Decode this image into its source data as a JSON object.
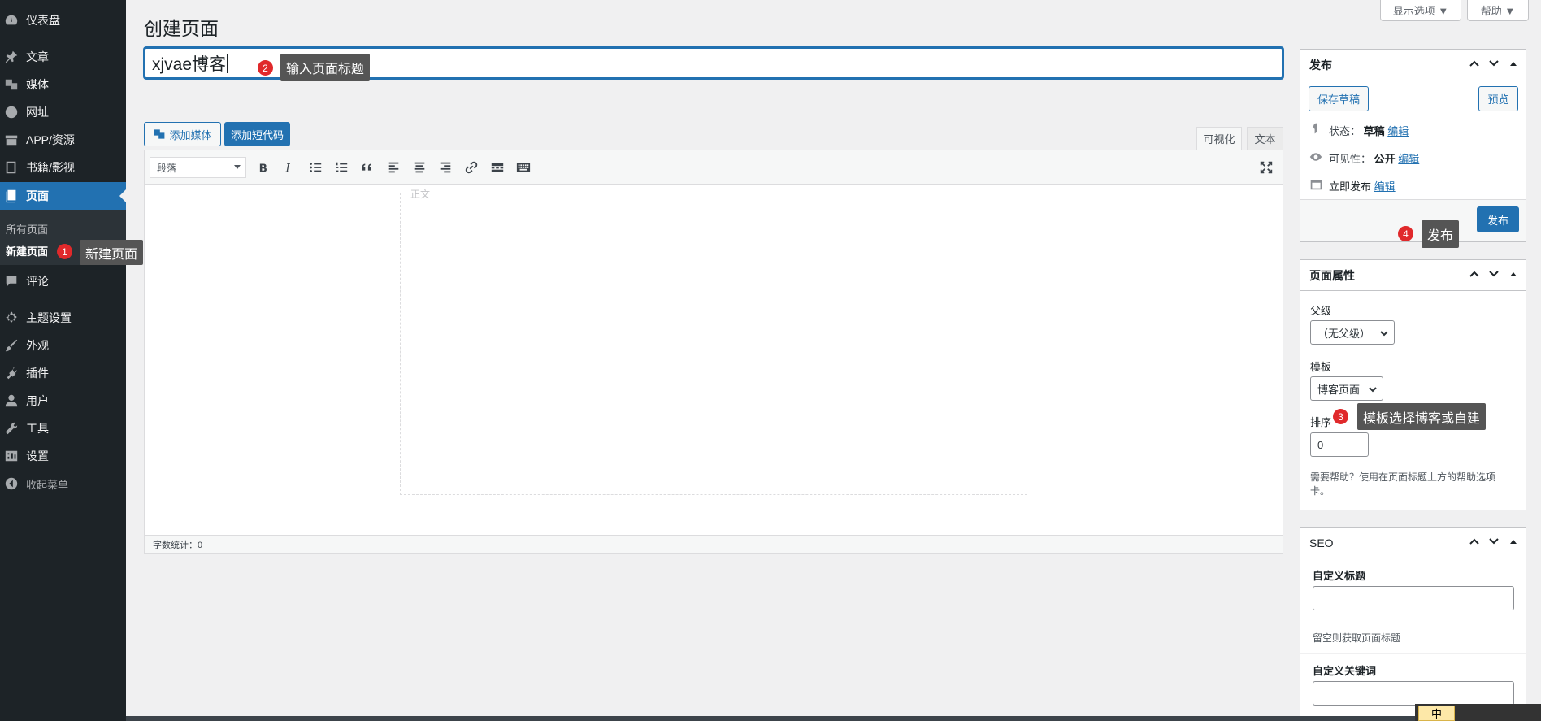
{
  "sidebar": {
    "items": [
      {
        "label": "仪表盘",
        "icon": "dashboard-icon"
      },
      {
        "label": "文章",
        "icon": "pin-icon"
      },
      {
        "label": "媒体",
        "icon": "media-icon"
      },
      {
        "label": "网址",
        "icon": "globe-icon"
      },
      {
        "label": "APP/资源",
        "icon": "archive-icon"
      },
      {
        "label": "书籍/影视",
        "icon": "book-icon"
      },
      {
        "label": "页面",
        "icon": "page-icon"
      },
      {
        "label": "评论",
        "icon": "comment-icon"
      },
      {
        "label": "主题设置",
        "icon": "gear-icon"
      },
      {
        "label": "外观",
        "icon": "brush-icon"
      },
      {
        "label": "插件",
        "icon": "plugin-icon"
      },
      {
        "label": "用户",
        "icon": "user-icon"
      },
      {
        "label": "工具",
        "icon": "wrench-icon"
      },
      {
        "label": "设置",
        "icon": "settings-icon"
      },
      {
        "label": "收起菜单",
        "icon": "collapse-icon"
      }
    ],
    "submenu": {
      "all_pages": "所有页面",
      "new_page": "新建页面"
    }
  },
  "annotations": {
    "step1": {
      "num": "1",
      "text": "新建页面"
    },
    "step2": {
      "num": "2",
      "text": "输入页面标题"
    },
    "step3": {
      "num": "3",
      "text": "模板选择博客或自建"
    },
    "step4": {
      "num": "4",
      "text": "发布"
    }
  },
  "header": {
    "title": "创建页面",
    "screen_options": "显示选项 ▼",
    "help": "帮助 ▼"
  },
  "editor": {
    "title_value": "xjvae博客",
    "add_media": "添加媒体",
    "add_shortcode": "添加短代码",
    "tab_visual": "可视化",
    "tab_text": "文本",
    "format_select": "段落",
    "body_legend": "正文",
    "word_count": "字数统计：0",
    "toolbar_icons": [
      "bold-icon",
      "italic-icon",
      "bullet-list-icon",
      "numbered-list-icon",
      "blockquote-icon",
      "align-left-icon",
      "align-center-icon",
      "align-right-icon",
      "link-icon",
      "more-tag-icon",
      "toolbar-toggle-icon"
    ]
  },
  "publish": {
    "title": "发布",
    "save_draft": "保存草稿",
    "preview": "预览",
    "status_label": "状态：",
    "status_value": "草稿",
    "visibility_label": "可见性：",
    "visibility_value": "公开",
    "schedule_label": "立即发布",
    "edit": "编辑",
    "publish_button": "发布"
  },
  "page_attributes": {
    "title": "页面属性",
    "parent_label": "父级",
    "parent_value": "（无父级）",
    "template_label": "模板",
    "template_value": "博客页面",
    "order_label": "排序",
    "order_value": "0",
    "help_text_1": "需要帮助？使用在页面标题上方的帮助选项",
    "help_text_2": "卡。"
  },
  "seo": {
    "title": "SEO",
    "custom_title_label": "自定义标题",
    "custom_title_hint": "留空则获取页面标题",
    "custom_keywords_label": "自定义关键词"
  },
  "ime": {
    "label": "中"
  },
  "colors": {
    "accent": "#2271b1",
    "sidebar": "#1d2327",
    "badge": "#e0292b",
    "tooltip": "#555555"
  }
}
